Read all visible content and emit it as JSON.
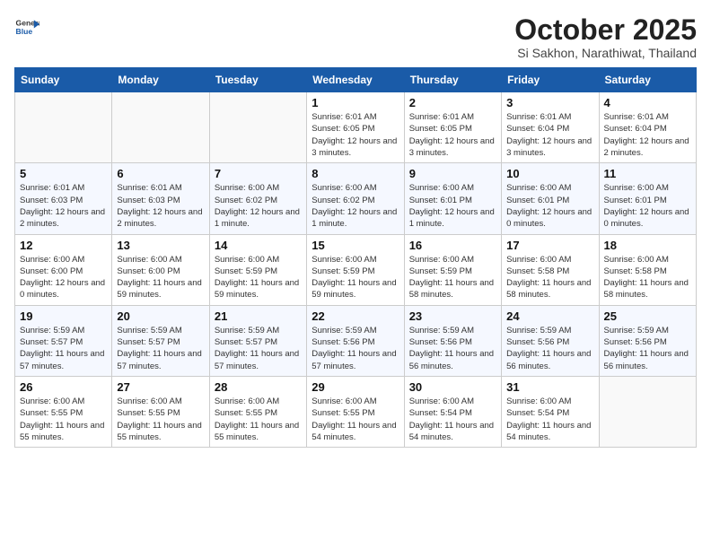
{
  "header": {
    "logo": {
      "general": "General",
      "blue": "Blue"
    },
    "title": "October 2025",
    "location": "Si Sakhon, Narathiwat, Thailand"
  },
  "weekdays": [
    "Sunday",
    "Monday",
    "Tuesday",
    "Wednesday",
    "Thursday",
    "Friday",
    "Saturday"
  ],
  "weeks": [
    [
      {
        "day": "",
        "info": ""
      },
      {
        "day": "",
        "info": ""
      },
      {
        "day": "",
        "info": ""
      },
      {
        "day": "1",
        "info": "Sunrise: 6:01 AM\nSunset: 6:05 PM\nDaylight: 12 hours and 3 minutes."
      },
      {
        "day": "2",
        "info": "Sunrise: 6:01 AM\nSunset: 6:05 PM\nDaylight: 12 hours and 3 minutes."
      },
      {
        "day": "3",
        "info": "Sunrise: 6:01 AM\nSunset: 6:04 PM\nDaylight: 12 hours and 3 minutes."
      },
      {
        "day": "4",
        "info": "Sunrise: 6:01 AM\nSunset: 6:04 PM\nDaylight: 12 hours and 2 minutes."
      }
    ],
    [
      {
        "day": "5",
        "info": "Sunrise: 6:01 AM\nSunset: 6:03 PM\nDaylight: 12 hours and 2 minutes."
      },
      {
        "day": "6",
        "info": "Sunrise: 6:01 AM\nSunset: 6:03 PM\nDaylight: 12 hours and 2 minutes."
      },
      {
        "day": "7",
        "info": "Sunrise: 6:00 AM\nSunset: 6:02 PM\nDaylight: 12 hours and 1 minute."
      },
      {
        "day": "8",
        "info": "Sunrise: 6:00 AM\nSunset: 6:02 PM\nDaylight: 12 hours and 1 minute."
      },
      {
        "day": "9",
        "info": "Sunrise: 6:00 AM\nSunset: 6:01 PM\nDaylight: 12 hours and 1 minute."
      },
      {
        "day": "10",
        "info": "Sunrise: 6:00 AM\nSunset: 6:01 PM\nDaylight: 12 hours and 0 minutes."
      },
      {
        "day": "11",
        "info": "Sunrise: 6:00 AM\nSunset: 6:01 PM\nDaylight: 12 hours and 0 minutes."
      }
    ],
    [
      {
        "day": "12",
        "info": "Sunrise: 6:00 AM\nSunset: 6:00 PM\nDaylight: 12 hours and 0 minutes."
      },
      {
        "day": "13",
        "info": "Sunrise: 6:00 AM\nSunset: 6:00 PM\nDaylight: 11 hours and 59 minutes."
      },
      {
        "day": "14",
        "info": "Sunrise: 6:00 AM\nSunset: 5:59 PM\nDaylight: 11 hours and 59 minutes."
      },
      {
        "day": "15",
        "info": "Sunrise: 6:00 AM\nSunset: 5:59 PM\nDaylight: 11 hours and 59 minutes."
      },
      {
        "day": "16",
        "info": "Sunrise: 6:00 AM\nSunset: 5:59 PM\nDaylight: 11 hours and 58 minutes."
      },
      {
        "day": "17",
        "info": "Sunrise: 6:00 AM\nSunset: 5:58 PM\nDaylight: 11 hours and 58 minutes."
      },
      {
        "day": "18",
        "info": "Sunrise: 6:00 AM\nSunset: 5:58 PM\nDaylight: 11 hours and 58 minutes."
      }
    ],
    [
      {
        "day": "19",
        "info": "Sunrise: 5:59 AM\nSunset: 5:57 PM\nDaylight: 11 hours and 57 minutes."
      },
      {
        "day": "20",
        "info": "Sunrise: 5:59 AM\nSunset: 5:57 PM\nDaylight: 11 hours and 57 minutes."
      },
      {
        "day": "21",
        "info": "Sunrise: 5:59 AM\nSunset: 5:57 PM\nDaylight: 11 hours and 57 minutes."
      },
      {
        "day": "22",
        "info": "Sunrise: 5:59 AM\nSunset: 5:56 PM\nDaylight: 11 hours and 57 minutes."
      },
      {
        "day": "23",
        "info": "Sunrise: 5:59 AM\nSunset: 5:56 PM\nDaylight: 11 hours and 56 minutes."
      },
      {
        "day": "24",
        "info": "Sunrise: 5:59 AM\nSunset: 5:56 PM\nDaylight: 11 hours and 56 minutes."
      },
      {
        "day": "25",
        "info": "Sunrise: 5:59 AM\nSunset: 5:56 PM\nDaylight: 11 hours and 56 minutes."
      }
    ],
    [
      {
        "day": "26",
        "info": "Sunrise: 6:00 AM\nSunset: 5:55 PM\nDaylight: 11 hours and 55 minutes."
      },
      {
        "day": "27",
        "info": "Sunrise: 6:00 AM\nSunset: 5:55 PM\nDaylight: 11 hours and 55 minutes."
      },
      {
        "day": "28",
        "info": "Sunrise: 6:00 AM\nSunset: 5:55 PM\nDaylight: 11 hours and 55 minutes."
      },
      {
        "day": "29",
        "info": "Sunrise: 6:00 AM\nSunset: 5:55 PM\nDaylight: 11 hours and 54 minutes."
      },
      {
        "day": "30",
        "info": "Sunrise: 6:00 AM\nSunset: 5:54 PM\nDaylight: 11 hours and 54 minutes."
      },
      {
        "day": "31",
        "info": "Sunrise: 6:00 AM\nSunset: 5:54 PM\nDaylight: 11 hours and 54 minutes."
      },
      {
        "day": "",
        "info": ""
      }
    ]
  ]
}
